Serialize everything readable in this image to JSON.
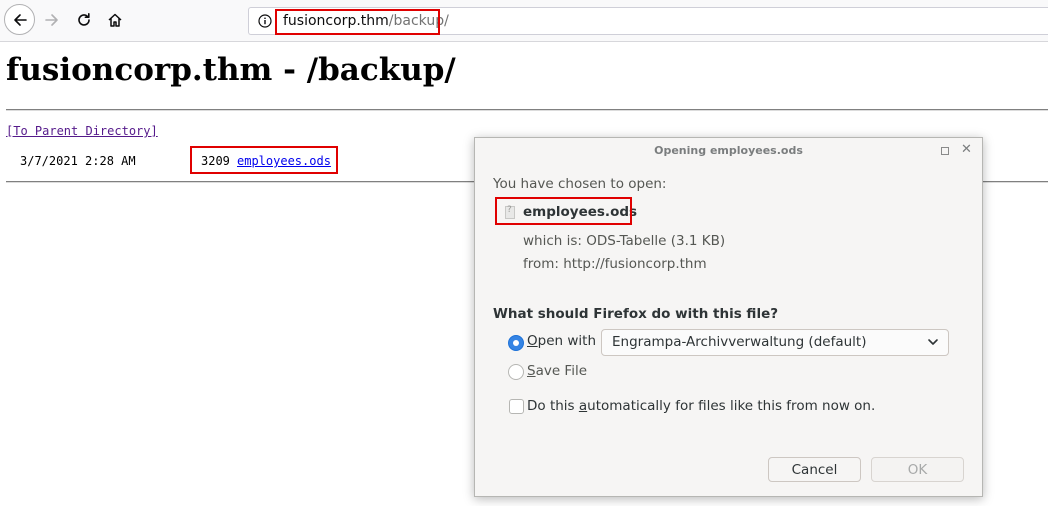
{
  "browser": {
    "url_host": "fusioncorp.thm",
    "url_path": "/backup/",
    "icons": {
      "back": "arrow-left-icon",
      "forward": "arrow-right-icon",
      "reload": "reload-icon",
      "home": "home-icon",
      "site_info": "info-icon"
    }
  },
  "page": {
    "title": "fusioncorp.thm - /backup/",
    "parent_link": "[To Parent Directory]",
    "entries": [
      {
        "date": "3/7/2021  2:28 AM",
        "size": "3209",
        "name": "employees.ods"
      }
    ]
  },
  "dialog": {
    "title": "Opening employees.ods",
    "chosen_label": "You have chosen to open:",
    "filename": "employees.ods",
    "which_is": "which is:  ODS-Tabelle (3.1 KB)",
    "from": "from:  http://fusioncorp.thm",
    "question": "What should Firefox do with this file?",
    "open_with": {
      "pre": "",
      "mnemonic": "O",
      "post": "pen with"
    },
    "open_with_app": "Engrampa-Archivverwaltung (default)",
    "save_file": {
      "pre": "",
      "mnemonic": "S",
      "post": "ave File"
    },
    "auto": {
      "pre": "Do this ",
      "mnemonic": "a",
      "post": "utomatically for files like this from now on."
    },
    "cancel": "Cancel",
    "ok": "OK",
    "selected_option": "open_with",
    "auto_checked": false,
    "close_symbol": "✕"
  },
  "colors": {
    "highlight": "#e00000",
    "link": "#0000ee",
    "visited_link": "#551a8b",
    "radio_selected": "#3584e4"
  }
}
